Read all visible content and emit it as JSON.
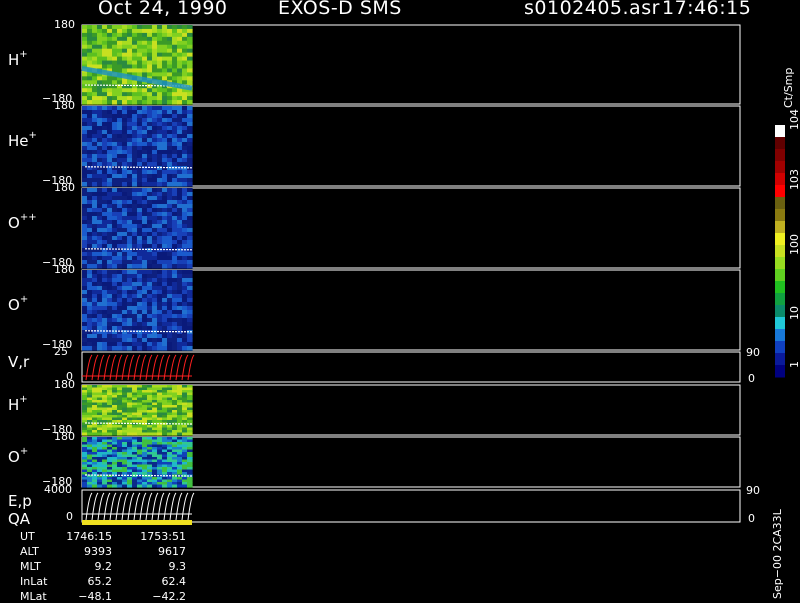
{
  "header": {
    "date": "Oct 24, 1990",
    "title": "EXOS-D SMS",
    "file": "s0102405.asr",
    "time": "17:46:15"
  },
  "colorbar": {
    "unit": "Ct/Smp",
    "labels": [
      "1",
      "10",
      "100",
      "10",
      "10"
    ],
    "exponents": [
      "",
      "",
      "",
      "3",
      "4"
    ],
    "colors": [
      "#000080",
      "#0a1a9a",
      "#1040c0",
      "#1878d8",
      "#20c8d8",
      "#0a8a6a",
      "#10a040",
      "#20c020",
      "#60d020",
      "#98dc20",
      "#c8e020",
      "#f0f020",
      "#c0b020",
      "#8a7a10",
      "#6a6010",
      "#ff0000",
      "#d00000",
      "#a00000",
      "#800000",
      "#600000",
      "#ffffff"
    ]
  },
  "panels": [
    {
      "id": "h-plus-1",
      "label": "H",
      "sup": "+",
      "ytop": "180",
      "ybot": "−180",
      "palette": "green"
    },
    {
      "id": "he-plus",
      "label": "He",
      "sup": "+",
      "ytop": "180",
      "ybot": "−180",
      "palette": "blue"
    },
    {
      "id": "o-plus-plus",
      "label": "O",
      "sup": "++",
      "ytop": "180",
      "ybot": "−180",
      "palette": "blue"
    },
    {
      "id": "o-plus-1",
      "label": "O",
      "sup": "+",
      "ytop": "180",
      "ybot": "−180",
      "palette": "blue"
    },
    {
      "id": "vr",
      "label": "V,r",
      "sup": "",
      "ytop": "25",
      "ybot": "0",
      "rtop": "90",
      "rbot": "0",
      "palette": "line"
    },
    {
      "id": "h-plus-2",
      "label": "H",
      "sup": "+",
      "ytop": "180",
      "ybot": "−180",
      "palette": "green"
    },
    {
      "id": "o-plus-2",
      "label": "O",
      "sup": "+",
      "ytop": "180",
      "ybot": "−180",
      "palette": "cyan"
    },
    {
      "id": "ep",
      "label": "E,p",
      "sup": "",
      "label2": "QA",
      "ytop": "4000",
      "ybot": "0",
      "rtop": "90",
      "rbot": "0",
      "palette": "line"
    }
  ],
  "info": {
    "rows": [
      {
        "name": "UT",
        "v1": "1746:15",
        "v2": "1753:51"
      },
      {
        "name": "ALT",
        "v1": "9393",
        "v2": "9617"
      },
      {
        "name": "MLT",
        "v1": "9.2",
        "v2": "9.3"
      },
      {
        "name": "InLat",
        "v1": "65.2",
        "v2": "62.4"
      },
      {
        "name": "MLat",
        "v1": "−48.1",
        "v2": "−42.2"
      }
    ]
  },
  "footer": {
    "code": "Sep−00 2CA33L"
  },
  "chart_data": {
    "type": "heatmap",
    "title": "EXOS-D SMS",
    "time_range": [
      "1746:15",
      "1753:51"
    ],
    "panels": [
      {
        "name": "H+",
        "yrange": [
          -180,
          180
        ]
      },
      {
        "name": "He+",
        "yrange": [
          -180,
          180
        ]
      },
      {
        "name": "O++",
        "yrange": [
          -180,
          180
        ]
      },
      {
        "name": "O+",
        "yrange": [
          -180,
          180
        ]
      },
      {
        "name": "V,r",
        "yrange": [
          0,
          25
        ],
        "y2range": [
          0,
          90
        ]
      },
      {
        "name": "H+",
        "yrange": [
          -180,
          180
        ]
      },
      {
        "name": "O+",
        "yrange": [
          -180,
          180
        ]
      },
      {
        "name": "E,p",
        "yrange": [
          0,
          4000
        ],
        "y2range": [
          0,
          90
        ]
      }
    ],
    "colorbar_range": [
      1,
      10000
    ],
    "colorbar_scale": "log"
  }
}
